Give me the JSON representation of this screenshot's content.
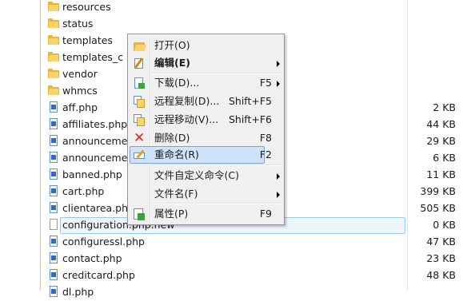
{
  "files": [
    {
      "name": "resources",
      "type": "folder",
      "size": ""
    },
    {
      "name": "status",
      "type": "folder",
      "size": ""
    },
    {
      "name": "templates",
      "type": "folder",
      "size": ""
    },
    {
      "name": "templates_c",
      "type": "folder",
      "size": ""
    },
    {
      "name": "vendor",
      "type": "folder",
      "size": ""
    },
    {
      "name": "whmcs",
      "type": "folder",
      "size": ""
    },
    {
      "name": "aff.php",
      "type": "php",
      "size": "2 KB"
    },
    {
      "name": "affiliates.php",
      "type": "php",
      "size": "44 KB"
    },
    {
      "name": "announcements.php",
      "type": "php",
      "size": "29 KB"
    },
    {
      "name": "announcements.php",
      "type": "php",
      "size": "6 KB"
    },
    {
      "name": "banned.php",
      "type": "php",
      "size": "11 KB"
    },
    {
      "name": "cart.php",
      "type": "php",
      "size": "399 KB"
    },
    {
      "name": "clientarea.php",
      "type": "php",
      "size": "505 KB"
    },
    {
      "name": "configuration.php.new",
      "type": "new",
      "size": "0 KB"
    },
    {
      "name": "configuressl.php",
      "type": "php",
      "size": "47 KB"
    },
    {
      "name": "contact.php",
      "type": "php",
      "size": "23 KB"
    },
    {
      "name": "creditcard.php",
      "type": "php",
      "size": "48 KB"
    },
    {
      "name": "dl.php",
      "type": "php",
      "size": ""
    }
  ],
  "context_menu": {
    "items": [
      {
        "label": "打开(O)",
        "shortcut": "",
        "icon": "open-folder-icon",
        "submenu": false,
        "bold": false
      },
      {
        "label": "编辑(E)",
        "shortcut": "",
        "icon": "edit-icon",
        "submenu": true,
        "bold": true
      },
      {
        "label": "下载(D)...",
        "shortcut": "F5",
        "icon": "download-icon",
        "submenu": true,
        "bold": false
      },
      {
        "label": "远程复制(D)...",
        "shortcut": "Shift+F5",
        "icon": "remote-copy-icon",
        "submenu": false,
        "bold": false
      },
      {
        "label": "远程移动(V)...",
        "shortcut": "Shift+F6",
        "icon": "remote-move-icon",
        "submenu": false,
        "bold": false
      },
      {
        "label": "删除(D)",
        "shortcut": "F8",
        "icon": "delete-icon",
        "submenu": false,
        "bold": false
      },
      {
        "label": "重命名(R)",
        "shortcut": "F2",
        "icon": "rename-icon",
        "submenu": false,
        "bold": false
      },
      {
        "label": "文件自定义命令(C)",
        "shortcut": "",
        "icon": "",
        "submenu": true,
        "bold": false
      },
      {
        "label": "文件名(F)",
        "shortcut": "",
        "icon": "",
        "submenu": true,
        "bold": false
      },
      {
        "label": "属性(P)",
        "shortcut": "F9",
        "icon": "properties-icon",
        "submenu": false,
        "bold": false
      }
    ],
    "highlighted_index": 6
  },
  "colors": {
    "menu_highlight": "#cfe3fb",
    "selection": "#eef6fd",
    "folder": "#e8b43a",
    "delete": "#d52b1e"
  }
}
